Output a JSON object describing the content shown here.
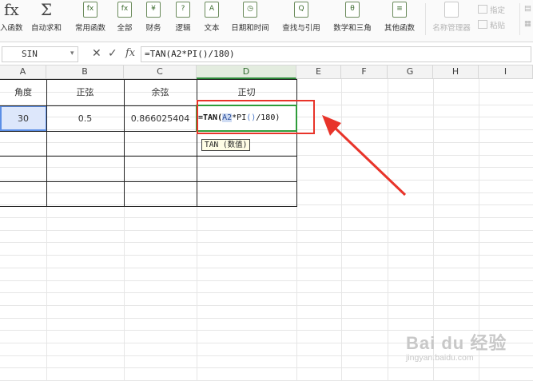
{
  "ribbon": {
    "items": [
      {
        "label": "入函数",
        "icon": "fx"
      },
      {
        "label": "自动求和",
        "icon": "Σ"
      },
      {
        "label": "常用函数",
        "icon": "fx"
      },
      {
        "label": "全部",
        "icon": "fx"
      },
      {
        "label": "财务",
        "icon": "¥"
      },
      {
        "label": "逻辑",
        "icon": "?"
      },
      {
        "label": "文本",
        "icon": "A"
      },
      {
        "label": "日期和时间",
        "icon": "◷"
      },
      {
        "label": "查找与引用",
        "icon": "Q"
      },
      {
        "label": "数学和三角",
        "icon": "θ"
      },
      {
        "label": "其他函数",
        "icon": "≡"
      }
    ],
    "right": {
      "name_manager": "名称管理器",
      "specify": "指定",
      "paste": "粘贴"
    }
  },
  "formula_bar": {
    "name_box": "SIN",
    "cancel": "✕",
    "confirm": "✓",
    "fx": "fx",
    "formula": "=TAN(A2*PI()/180)"
  },
  "columns": [
    "A",
    "B",
    "C",
    "D",
    "E",
    "F",
    "G",
    "H",
    "I"
  ],
  "table": {
    "headers": [
      "角度",
      "正弦",
      "余弦",
      "正切"
    ],
    "row": [
      "30",
      "0.5",
      "0.866025404"
    ]
  },
  "editing": {
    "prefix": "=TAN(",
    "ref": "A2",
    "mid": "*PI",
    "paren_pair": "()",
    "tail": "/180)",
    "tooltip": "TAN (数值)"
  },
  "watermark": {
    "brand": "Bai du 经验",
    "url": "jingyan.baidu.com"
  },
  "colors": {
    "active_col": "#2e8b3a",
    "selection": "#5b8ee6",
    "annotation": "#e8342a"
  }
}
